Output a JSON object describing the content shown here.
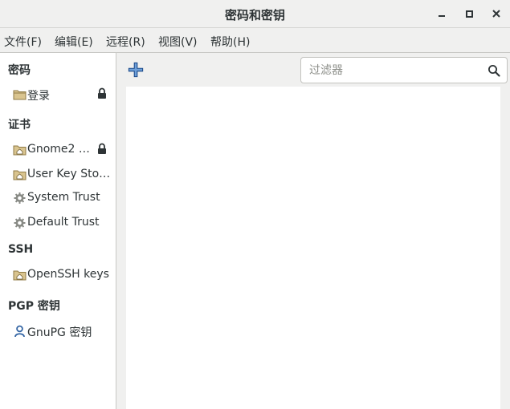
{
  "window": {
    "title": "密码和密钥",
    "controls": {
      "minimize": "minimize-icon",
      "maximize": "maximize-icon",
      "close": "close-icon"
    }
  },
  "menubar": {
    "items": [
      {
        "label": "文件(F)"
      },
      {
        "label": "编辑(E)"
      },
      {
        "label": "远程(R)"
      },
      {
        "label": "视图(V)"
      },
      {
        "label": "帮助(H)"
      }
    ]
  },
  "sidebar": {
    "sections": [
      {
        "title": "密码",
        "items": [
          {
            "label": "登录",
            "icon": "folder-icon",
            "locked": true
          }
        ]
      },
      {
        "title": "证书",
        "items": [
          {
            "label": "Gnome2 …",
            "icon": "folder-home-icon",
            "locked": true
          },
          {
            "label": "User Key Storage",
            "icon": "folder-home-icon",
            "locked": false
          },
          {
            "label": "System Trust",
            "icon": "gear-icon",
            "locked": false
          },
          {
            "label": "Default Trust",
            "icon": "gear-icon",
            "locked": false
          }
        ]
      },
      {
        "title": "SSH",
        "items": [
          {
            "label": "OpenSSH keys",
            "icon": "folder-home-icon",
            "locked": false
          }
        ]
      },
      {
        "title": "PGP 密钥",
        "items": [
          {
            "label": "GnuPG 密钥",
            "icon": "key-person-icon",
            "locked": false
          }
        ]
      }
    ]
  },
  "toolbar": {
    "add_icon": "plus-icon"
  },
  "search": {
    "placeholder": "过滤器",
    "value": "",
    "icon": "search-icon"
  },
  "colors": {
    "accent": "#3465a4",
    "window_bg": "#f0f0ef",
    "text": "#2e3436",
    "folder": "#c4a86a"
  }
}
